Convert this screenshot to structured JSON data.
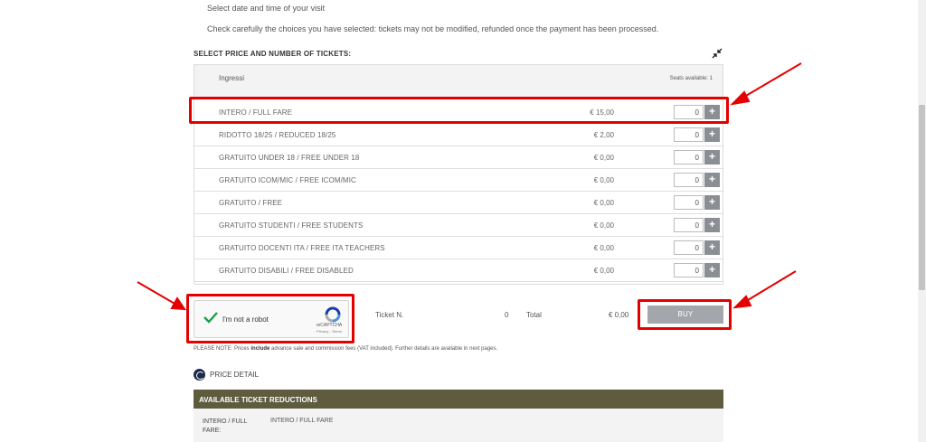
{
  "intro": {
    "line1": "Select date and time of your visit",
    "line2": "Check carefully the choices you have selected: tickets may not be modified, refunded once the payment has been processed."
  },
  "section_title": "SELECT PRICE AND NUMBER OF TICKETS:",
  "collapse_icon": "collapse-arrows-icon",
  "panel": {
    "title": "Ingressi",
    "seats": "Seats available: 1"
  },
  "tickets": [
    {
      "name": "INTERO / FULL FARE",
      "price": "€ 15,00",
      "qty": "0"
    },
    {
      "name": "RIDOTTO 18/25 / REDUCED 18/25",
      "price": "€ 2,00",
      "qty": "0"
    },
    {
      "name": "GRATUITO UNDER 18 / FREE UNDER 18",
      "price": "€ 0,00",
      "qty": "0"
    },
    {
      "name": "GRATUITO ICOM/MIC / FREE ICOM/MIC",
      "price": "€ 0,00",
      "qty": "0"
    },
    {
      "name": "GRATUITO / FREE",
      "price": "€ 0,00",
      "qty": "0"
    },
    {
      "name": "GRATUITO STUDENTI / FREE STUDENTS",
      "price": "€ 0,00",
      "qty": "0"
    },
    {
      "name": "GRATUITO DOCENTI ITA / FREE ITA TEACHERS",
      "price": "€ 0,00",
      "qty": "0"
    },
    {
      "name": "GRATUITO DISABILI / FREE DISABLED",
      "price": "€ 0,00",
      "qty": "0"
    }
  ],
  "plus_label": "+",
  "recaptcha": {
    "label": "I'm not a robot",
    "brand": "reCAPTCHA",
    "terms": "Privacy - Terms"
  },
  "summary": {
    "ticket_label": "Ticket N.",
    "ticket_count": "0",
    "total_label": "Total",
    "total_value": "€ 0,00"
  },
  "buy_label": "BUY",
  "note": {
    "prefix": "PLEASE NOTE: Prices ",
    "bold": "include",
    "suffix": " advance sale and commission fees (VAT included). Further details are available in next pages."
  },
  "price_detail_label": "PRICE DETAIL",
  "reductions": {
    "title": "AVAILABLE TICKET REDUCTIONS",
    "key": "INTERO / FULL FARE:",
    "value": "INTERO / FULL FARE"
  },
  "colors": {
    "highlight": "#e50000",
    "reductions_bar": "#5e5b3f",
    "buy_button": "#a3a7ab",
    "plus_button": "#8b8f94"
  }
}
